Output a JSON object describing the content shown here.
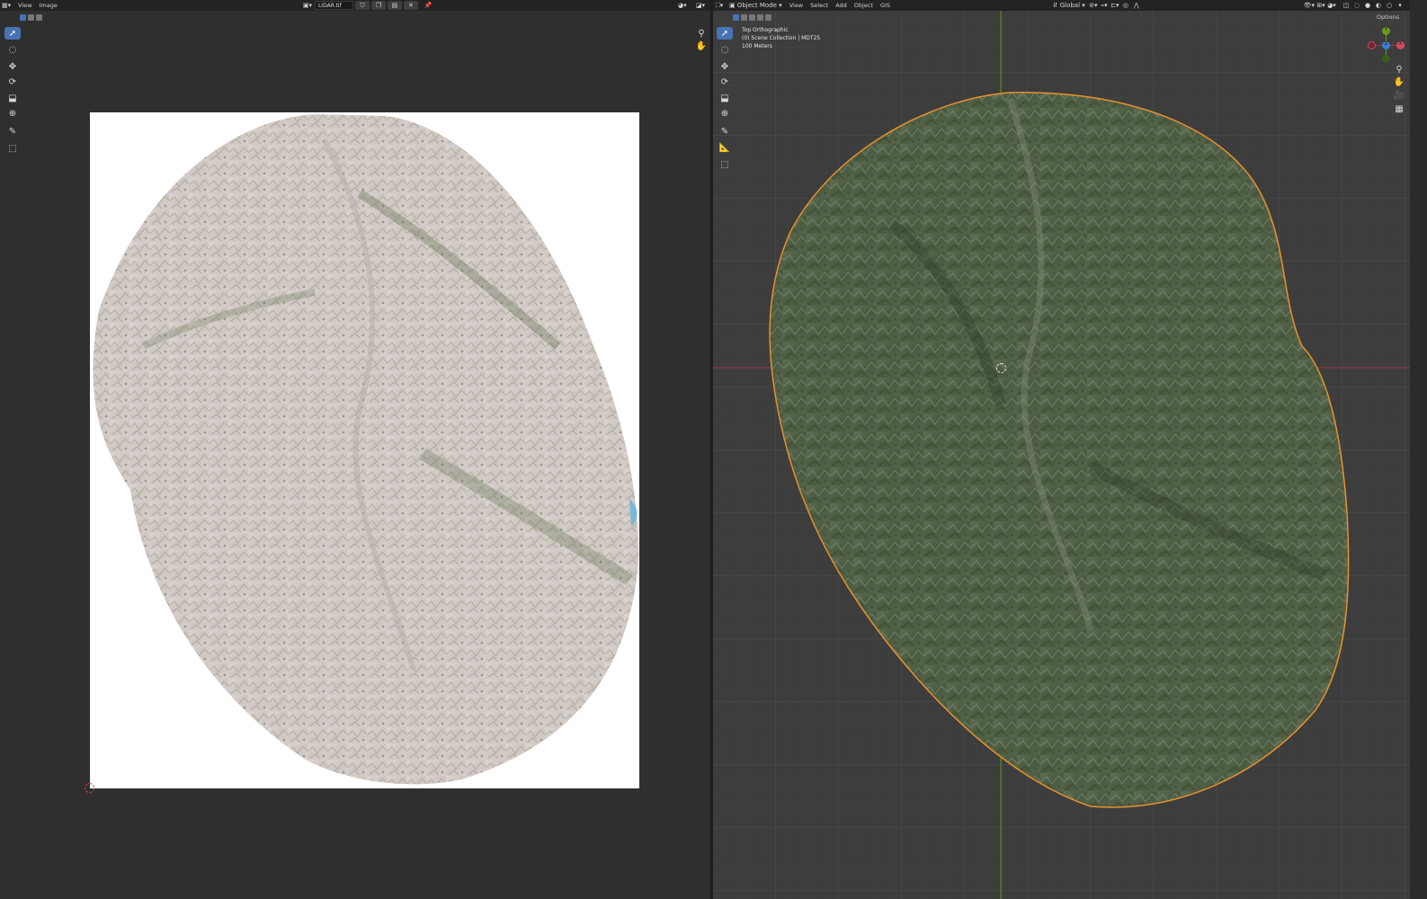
{
  "left_editor": {
    "header": {
      "menus": [
        "View",
        "Image"
      ],
      "image_name": "LIDAR.tif"
    },
    "tools": [
      "select-tool",
      "cursor-tool",
      "move-tool",
      "rotate-tool",
      "scale-tool",
      "transform-tool",
      "annotate-tool",
      "sample-tool"
    ]
  },
  "right_editor": {
    "header": {
      "mode": "Object Mode",
      "menus": [
        "View",
        "Select",
        "Add",
        "Object",
        "GIS"
      ],
      "orientation": "Global",
      "options_label": "Options"
    },
    "overlay": {
      "view_name": "Top Orthographic",
      "collection": "(0) Scene Collection | MDT25",
      "scale": "100 Meters"
    },
    "gizmo_axes": [
      "X",
      "Y",
      "Z"
    ],
    "colors": {
      "selection_outline": "#e8912d",
      "x_axis": "#a23a48",
      "y_axis": "#6a9a1f"
    }
  }
}
